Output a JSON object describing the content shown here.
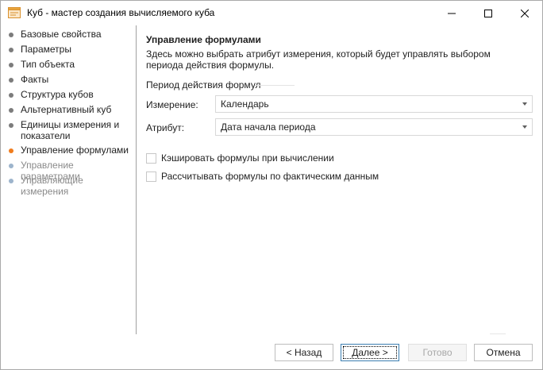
{
  "window": {
    "title": "Куб - мастер создания вычисляемого куба"
  },
  "sidebar": {
    "steps": [
      {
        "label": "Базовые свойства",
        "state": "done"
      },
      {
        "label": "Параметры",
        "state": "done"
      },
      {
        "label": "Тип объекта",
        "state": "done"
      },
      {
        "label": "Факты",
        "state": "done"
      },
      {
        "label": "Структура кубов",
        "state": "done"
      },
      {
        "label": "Альтернативный куб",
        "state": "done"
      },
      {
        "label": "Единицы измерения и показатели",
        "state": "done"
      },
      {
        "label": "Управление формулами",
        "state": "active"
      },
      {
        "label": "Управление параметрами",
        "state": "disabled"
      },
      {
        "label": "Управляющие измерения",
        "state": "disabled"
      }
    ]
  },
  "main": {
    "title": "Управление формулами",
    "description": "Здесь можно выбрать атрибут измерения, который будет управлять выбором периода действия формулы.",
    "section_label": "Период действия формул",
    "dimension": {
      "label": "Измерение:",
      "value": "Календарь"
    },
    "attribute": {
      "label": "Атрибут:",
      "value": "Дата начала периода"
    },
    "checkboxes": [
      {
        "label": "Кэшировать формулы при вычислении",
        "checked": false
      },
      {
        "label": "Рассчитывать формулы по фактическим данным",
        "checked": false
      }
    ]
  },
  "buttons": {
    "back": "< Назад",
    "next": "Далее >",
    "finish": "Готово",
    "cancel": "Отмена"
  },
  "colors": {
    "active_step": "#f07c1d",
    "done_step": "#7c7c7c",
    "disabled_step": "#9db4cc",
    "primary_border": "#3c7fb1"
  }
}
